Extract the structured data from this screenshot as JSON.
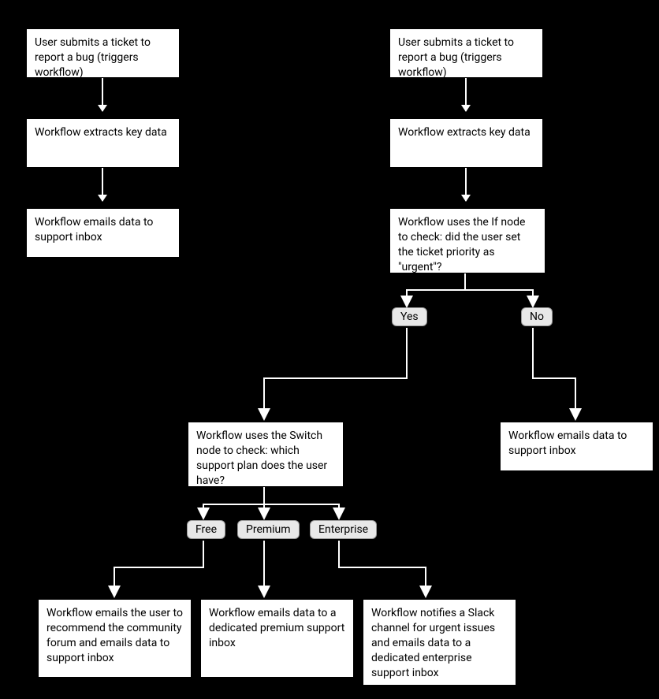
{
  "left": {
    "submit": "User submits a ticket to report a bug (triggers workflow)",
    "extract": "Workflow extracts key data",
    "email": "Workflow emails data to support inbox"
  },
  "right": {
    "submit": "User submits a ticket to report a bug (triggers workflow)",
    "extract": "Workflow extracts key data",
    "ifcheck": "Workflow uses the If node to check: did the user set the ticket priority as \"urgent\"?",
    "yes": "Yes",
    "no": "No",
    "switchcheck": "Workflow uses the Switch node to check: which support plan does the user have?",
    "free": "Free",
    "premium": "Premium",
    "enterprise": "Enterprise",
    "freeResult": "Workflow emails the user to recommend the community forum and emails data to support inbox",
    "premiumResult": "Workflow emails data to a dedicated premium support inbox",
    "enterpriseResult": "Workflow notifies a Slack channel for urgent issues and emails data to a dedicated enterprise support inbox",
    "noResult": "Workflow emails data to support inbox"
  }
}
